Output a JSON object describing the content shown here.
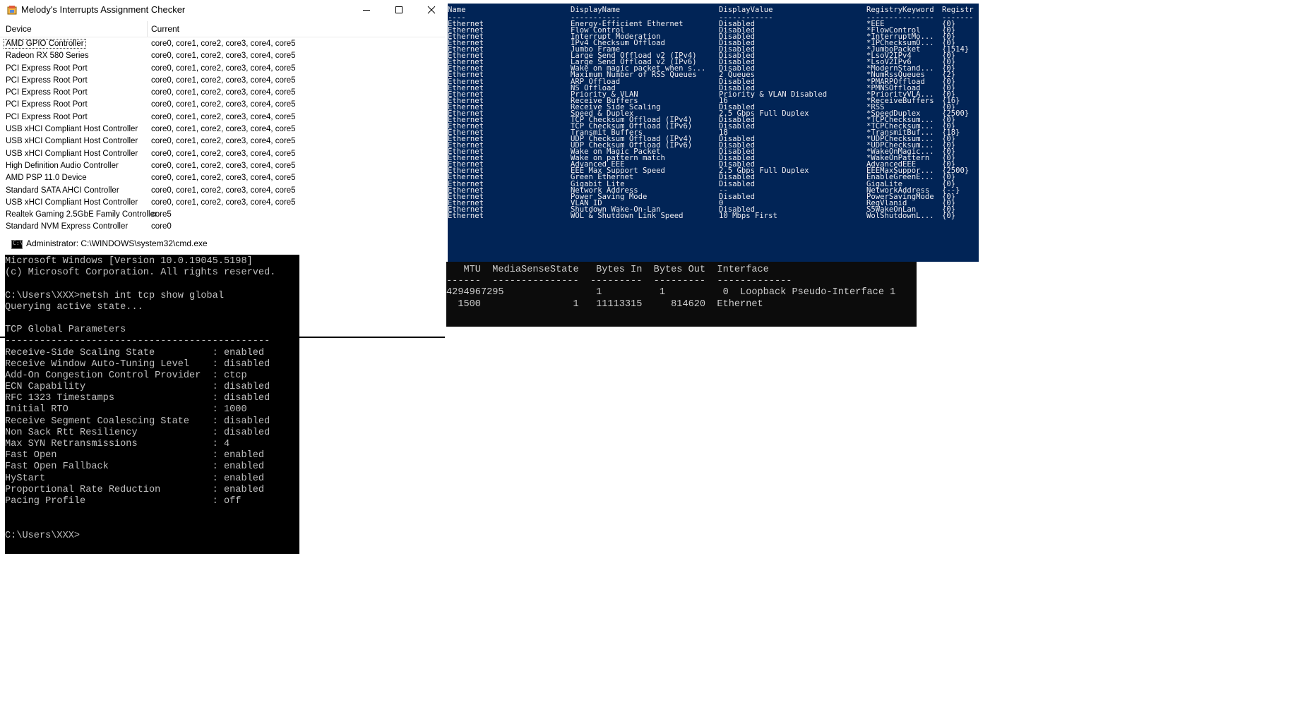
{
  "melody_window": {
    "title": "Melody's Interrupts Assignment Checker",
    "columns": {
      "device": "Device",
      "current": "Current"
    },
    "rows": [
      {
        "device": "AMD GPIO Controller",
        "current": "core0, core1, core2, core3, core4, core5"
      },
      {
        "device": "Radeon RX 580 Series",
        "current": "core0, core1, core2, core3, core4, core5"
      },
      {
        "device": "PCI Express Root Port",
        "current": "core0, core1, core2, core3, core4, core5"
      },
      {
        "device": "PCI Express Root Port",
        "current": "core0, core1, core2, core3, core4, core5"
      },
      {
        "device": "PCI Express Root Port",
        "current": "core0, core1, core2, core3, core4, core5"
      },
      {
        "device": "PCI Express Root Port",
        "current": "core0, core1, core2, core3, core4, core5"
      },
      {
        "device": "PCI Express Root Port",
        "current": "core0, core1, core2, core3, core4, core5"
      },
      {
        "device": "USB xHCI Compliant Host Controller",
        "current": "core0, core1, core2, core3, core4, core5"
      },
      {
        "device": "USB xHCI Compliant Host Controller",
        "current": "core0, core1, core2, core3, core4, core5"
      },
      {
        "device": "USB xHCI Compliant Host Controller",
        "current": "core0, core1, core2, core3, core4, core5"
      },
      {
        "device": "High Definition Audio Controller",
        "current": "core0, core1, core2, core3, core4, core5"
      },
      {
        "device": "AMD PSP 11.0 Device",
        "current": "core0, core1, core2, core3, core4, core5"
      },
      {
        "device": "Standard SATA AHCI Controller",
        "current": "core0, core1, core2, core3, core4, core5"
      },
      {
        "device": "USB xHCI Compliant Host Controller",
        "current": "core0, core1, core2, core3, core4, core5"
      },
      {
        "device": "Realtek Gaming 2.5GbE Family Controller",
        "current": "core5"
      },
      {
        "device": "Standard NVM Express Controller",
        "current": "core0"
      }
    ]
  },
  "cmd_window": {
    "title": "Administrator: C:\\WINDOWS\\system32\\cmd.exe",
    "lines": [
      "Microsoft Windows [Version 10.0.19045.5198]",
      "(c) Microsoft Corporation. All rights reserved.",
      "",
      "C:\\Users\\XXX>netsh int tcp show global",
      "Querying active state...",
      "",
      "TCP Global Parameters",
      "----------------------------------------------",
      "Receive-Side Scaling State          : enabled",
      "Receive Window Auto-Tuning Level    : disabled",
      "Add-On Congestion Control Provider  : ctcp",
      "ECN Capability                      : disabled",
      "RFC 1323 Timestamps                 : disabled",
      "Initial RTO                         : 1000",
      "Receive Segment Coalescing State    : disabled",
      "Non Sack Rtt Resiliency             : disabled",
      "Max SYN Retransmissions             : 4",
      "Fast Open                           : enabled",
      "Fast Open Fallback                  : enabled",
      "HyStart                             : enabled",
      "Proportional Rate Reduction         : enabled",
      "Pacing Profile                      : off",
      "",
      "",
      "C:\\Users\\XXX>"
    ]
  },
  "adapter_props": {
    "headers": [
      "Name",
      "DisplayName",
      "DisplayValue",
      "RegistryKeyword",
      "Registr"
    ],
    "underline": [
      "----",
      "-----------",
      "------------",
      "---------------",
      "-------"
    ],
    "rows": [
      [
        "Ethernet",
        "Energy-Efficient Ethernet",
        "Disabled",
        "*EEE",
        "{0}"
      ],
      [
        "Ethernet",
        "Flow Control",
        "Disabled",
        "*FlowControl",
        "{0}"
      ],
      [
        "Ethernet",
        "Interrupt Moderation",
        "Disabled",
        "*InterruptMo...",
        "{0}"
      ],
      [
        "Ethernet",
        "IPv4 Checksum Offload",
        "Disabled",
        "*IPChecksumO...",
        "{0}"
      ],
      [
        "Ethernet",
        "Jumbo Frame",
        "Disabled",
        "*JumboPacket",
        "{1514}"
      ],
      [
        "Ethernet",
        "Large Send Offload v2 (IPv4)",
        "Disabled",
        "*LsoV2IPv4",
        "{0}"
      ],
      [
        "Ethernet",
        "Large Send Offload v2 (IPv6)",
        "Disabled",
        "*LsoV2IPv6",
        "{0}"
      ],
      [
        "Ethernet",
        "Wake on magic packet when s...",
        "Disabled",
        "*ModernStand...",
        "{0}"
      ],
      [
        "Ethernet",
        "Maximum Number of RSS Queues",
        "2 Queues",
        "*NumRssQueues",
        "{2}"
      ],
      [
        "Ethernet",
        "ARP Offload",
        "Disabled",
        "*PMARPOffload",
        "{0}"
      ],
      [
        "Ethernet",
        "NS Offload",
        "Disabled",
        "*PMNSOffload",
        "{0}"
      ],
      [
        "Ethernet",
        "Priority & VLAN",
        "Priority & VLAN Disabled",
        "*PriorityVLA...",
        "{0}"
      ],
      [
        "Ethernet",
        "Receive Buffers",
        "16",
        "*ReceiveBuffers",
        "{16}"
      ],
      [
        "Ethernet",
        "Receive Side Scaling",
        "Disabled",
        "*RSS",
        "{0}"
      ],
      [
        "Ethernet",
        "Speed & Duplex",
        "2.5 Gbps Full Duplex",
        "*SpeedDuplex",
        "{2500}"
      ],
      [
        "Ethernet",
        "TCP Checksum Offload (IPv4)",
        "Disabled",
        "*TCPChecksum...",
        "{0}"
      ],
      [
        "Ethernet",
        "TCP Checksum Offload (IPv6)",
        "Disabled",
        "*TCPChecksum...",
        "{0}"
      ],
      [
        "Ethernet",
        "Transmit Buffers",
        "18",
        "*TransmitBuf...",
        "{18}"
      ],
      [
        "Ethernet",
        "UDP Checksum Offload (IPv4)",
        "Disabled",
        "*UDPChecksum...",
        "{0}"
      ],
      [
        "Ethernet",
        "UDP Checksum Offload (IPv6)",
        "Disabled",
        "*UDPChecksum...",
        "{0}"
      ],
      [
        "Ethernet",
        "Wake on Magic Packet",
        "Disabled",
        "*WakeOnMagic...",
        "{0}"
      ],
      [
        "Ethernet",
        "Wake on pattern match",
        "Disabled",
        "*WakeOnPattern",
        "{0}"
      ],
      [
        "Ethernet",
        "Advanced EEE",
        "Disabled",
        "AdvancedEEE",
        "{0}"
      ],
      [
        "Ethernet",
        "EEE Max Support Speed",
        "2.5 Gbps Full Duplex",
        "EEEMaxSuppor...",
        "{2500}"
      ],
      [
        "Ethernet",
        "Green Ethernet",
        "Disabled",
        "EnableGreenE...",
        "{0}"
      ],
      [
        "Ethernet",
        "Gigabit Lite",
        "Disabled",
        "GigaLite",
        "{0}"
      ],
      [
        "Ethernet",
        "Network Address",
        "--",
        "NetworkAddress",
        "{--}"
      ],
      [
        "Ethernet",
        "Power Saving Mode",
        "Disabled",
        "PowerSavingMode",
        "{0}"
      ],
      [
        "Ethernet",
        "VLAN ID",
        "0",
        "RegVlanid",
        "{0}"
      ],
      [
        "Ethernet",
        "Shutdown Wake-On-Lan",
        "Disabled",
        "S5WakeOnLan",
        "{0}"
      ],
      [
        "Ethernet",
        "WOL & Shutdown Link Speed",
        "10 Mbps First",
        "WolShutdownL...",
        "{0}"
      ]
    ]
  },
  "interface_table": {
    "lines": [
      "   MTU  MediaSenseState   Bytes In  Bytes Out  Interface",
      "------  ---------------  ---------  ---------  -------------",
      "4294967295                1          1          0  Loopback Pseudo-Interface 1",
      "  1500                1   11113315     814620  Ethernet"
    ]
  }
}
